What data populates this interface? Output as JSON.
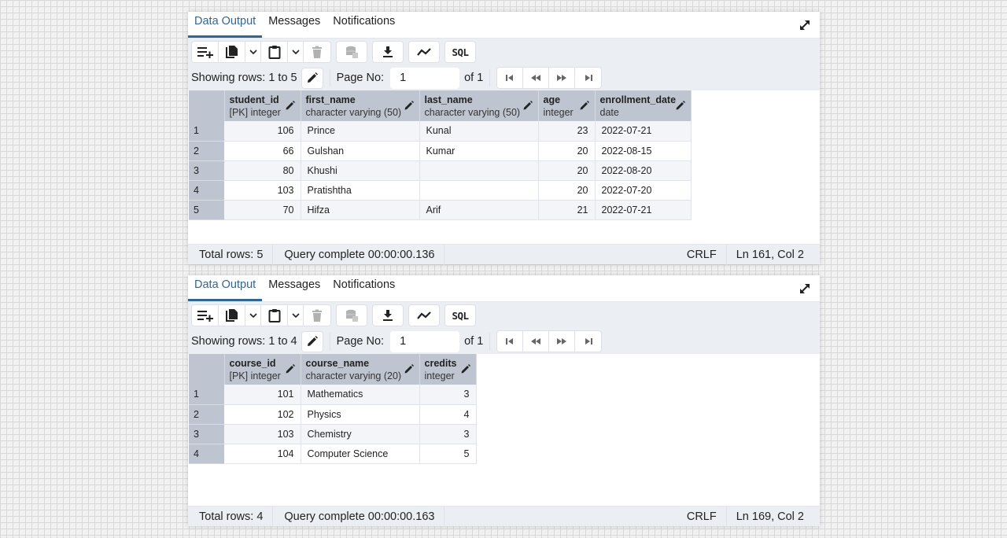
{
  "panels": [
    {
      "tabs": [
        {
          "label": "Data Output",
          "active": true
        },
        {
          "label": "Messages",
          "active": false
        },
        {
          "label": "Notifications",
          "active": false
        }
      ],
      "toolbar": {
        "add_row": "add-row-icon",
        "copy": "copy-icon",
        "paste": "paste-icon",
        "delete": "delete-icon",
        "save_data": "save-data-icon",
        "download": "download-icon",
        "graph": "graph-icon",
        "sql_label": "SQL"
      },
      "pager": {
        "showing_label": "Showing rows: 1 to 5",
        "page_no_label": "Page No:",
        "page_value": "1",
        "of_label": "of 1"
      },
      "columns": [
        {
          "name": "student_id",
          "type": "[PK] integer"
        },
        {
          "name": "first_name",
          "type": "character varying (50)"
        },
        {
          "name": "last_name",
          "type": "character varying (50)"
        },
        {
          "name": "age",
          "type": "integer"
        },
        {
          "name": "enrollment_date",
          "type": "date"
        }
      ],
      "rows": [
        {
          "n": "1",
          "cells": [
            "106",
            "Prince",
            "Kunal",
            "23",
            "2022-07-21"
          ]
        },
        {
          "n": "2",
          "cells": [
            "66",
            "Gulshan",
            "Kumar",
            "20",
            "2022-08-15"
          ]
        },
        {
          "n": "3",
          "cells": [
            "80",
            "Khushi",
            "",
            "20",
            "2022-08-20"
          ]
        },
        {
          "n": "4",
          "cells": [
            "103",
            "Pratishtha",
            "",
            "20",
            "2022-07-20"
          ]
        },
        {
          "n": "5",
          "cells": [
            "70",
            "Hifza",
            "Arif",
            "21",
            "2022-07-21"
          ]
        }
      ],
      "status": {
        "total_rows": "Total rows: 5",
        "query_status": "Query complete 00:00:00.136",
        "line_ending": "CRLF",
        "cursor_pos": "Ln 161, Col 2"
      }
    },
    {
      "tabs": [
        {
          "label": "Data Output",
          "active": true
        },
        {
          "label": "Messages",
          "active": false
        },
        {
          "label": "Notifications",
          "active": false
        }
      ],
      "toolbar": {
        "add_row": "add-row-icon",
        "copy": "copy-icon",
        "paste": "paste-icon",
        "delete": "delete-icon",
        "save_data": "save-data-icon",
        "download": "download-icon",
        "graph": "graph-icon",
        "sql_label": "SQL"
      },
      "pager": {
        "showing_label": "Showing rows: 1 to 4",
        "page_no_label": "Page No:",
        "page_value": "1",
        "of_label": "of 1"
      },
      "columns": [
        {
          "name": "course_id",
          "type": "[PK] integer"
        },
        {
          "name": "course_name",
          "type": "character varying (20)"
        },
        {
          "name": "credits",
          "type": "integer"
        }
      ],
      "rows": [
        {
          "n": "1",
          "cells": [
            "101",
            "Mathematics",
            "3"
          ]
        },
        {
          "n": "2",
          "cells": [
            "102",
            "Physics",
            "4"
          ]
        },
        {
          "n": "3",
          "cells": [
            "103",
            "Chemistry",
            "3"
          ]
        },
        {
          "n": "4",
          "cells": [
            "104",
            "Computer Science",
            "5"
          ]
        }
      ],
      "status": {
        "total_rows": "Total rows: 4",
        "query_status": "Query complete 00:00:00.163",
        "line_ending": "CRLF",
        "cursor_pos": "Ln 169, Col 2"
      }
    }
  ],
  "colors": {
    "accent": "#326690",
    "header_bg": "#bfc5d0",
    "toolbar_bg": "#ebeef3",
    "odd_row_bg": "#f3f5f8"
  }
}
